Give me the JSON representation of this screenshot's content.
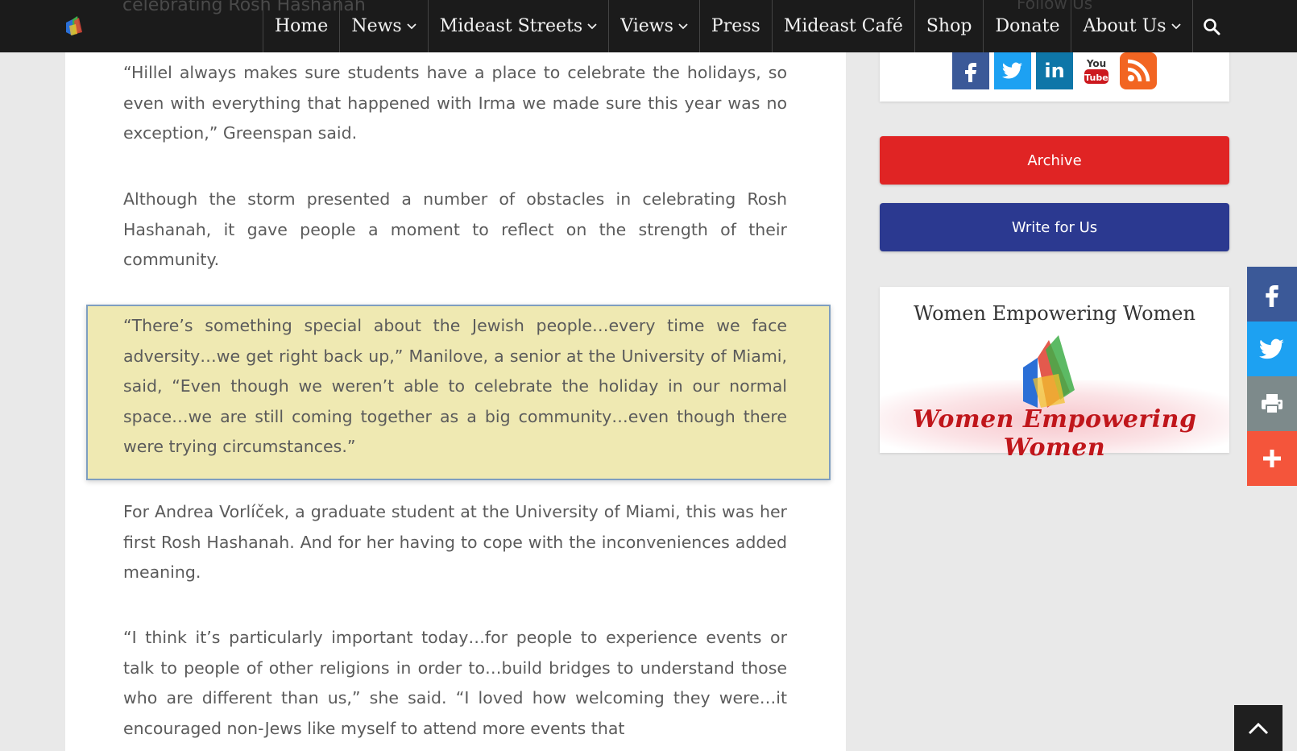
{
  "nav": {
    "logo": "site-logo",
    "ghost_heading": "celebrating Rosh Hashanah",
    "ghost_sidebar": "Follow Us",
    "items": [
      {
        "label": "Home",
        "dropdown": false
      },
      {
        "label": "News",
        "dropdown": true
      },
      {
        "label": "Mideast Streets",
        "dropdown": true
      },
      {
        "label": "Views",
        "dropdown": true
      },
      {
        "label": "Press",
        "dropdown": false
      },
      {
        "label": "Mideast Café",
        "dropdown": false
      },
      {
        "label": "Shop",
        "dropdown": false
      },
      {
        "label": "Donate",
        "dropdown": false
      },
      {
        "label": "About Us",
        "dropdown": true
      }
    ],
    "search_icon": "search-icon"
  },
  "article": {
    "paragraphs": [
      "“Hillel always makes sure students have a place to celebrate the holidays, so even with everything that happened with Irma we made sure this year was no exception,” Greenspan said.",
      "Although the storm presented a number of obstacles in celebrating Rosh Hashanah, it gave people a moment to reflect on the strength of their community.",
      "“There’s something special about the Jewish people…every time we face adversity…we get right back up,” Manilove, a senior at the University of Miami, said, “Even though we weren’t able to celebrate the holiday in our normal space…we are still coming together as a big community…even though there were trying circumstances.”",
      "For Andrea Vorlíček, a graduate student at the University of Miami, this was her first Rosh Hashanah. And for her having to cope with the inconveniences added meaning.",
      "“I think it’s particularly important today…for people to experience events or talk to people of other religions in order to…build bridges to understand those who are different than us,” she said. “I loved how welcoming they were…it encouraged non-Jews like myself to attend more events that"
    ],
    "highlight_color": "#efe9b2"
  },
  "sidebar": {
    "social_icons": [
      {
        "name": "facebook-icon",
        "glyph": "f",
        "color": "#3b5998"
      },
      {
        "name": "twitter-icon",
        "glyph": "t",
        "color": "#1da1f2"
      },
      {
        "name": "linkedin-icon",
        "glyph": "in",
        "color": "#0e76a8"
      },
      {
        "name": "youtube-icon",
        "glyph": "You",
        "color": "#cc181e"
      },
      {
        "name": "rss-icon",
        "glyph": "rss",
        "color": "#f26522"
      }
    ],
    "archive_label": "Archive",
    "archive_color": "#e02424",
    "write_label": "Write for Us",
    "write_color": "#2b3990",
    "promo_title": "Women Empowering Women",
    "promo_script": "Women Empowering Women"
  },
  "share_bar": {
    "buttons": [
      "facebook-share-icon",
      "twitter-share-icon",
      "print-icon",
      "plus-icon"
    ]
  },
  "back_to_top_icon": "chevron-up-icon"
}
